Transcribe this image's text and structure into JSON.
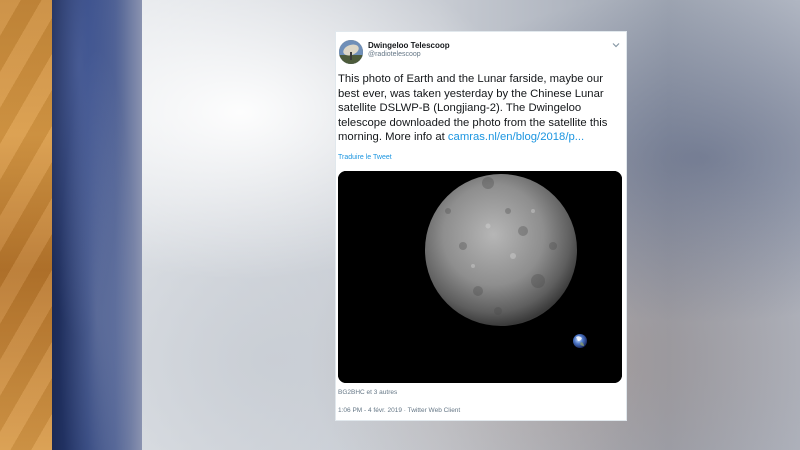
{
  "tweet": {
    "author_name": "Dwingeloo Telescoop",
    "author_handle": "@radiotelescoop",
    "text_main": "This photo of Earth and the Lunar farside, maybe our best ever, was taken yesterday by the Chinese Lunar satellite DSLWP-B (Longjiang-2). The Dwingeloo telescope downloaded the photo from the satellite this morning. More info at ",
    "text_link": "camras.nl/en/blog/2018/p...",
    "translate_label": "Traduire le Tweet",
    "likers": "BG2BHC et 3 autres",
    "timestamp": "1:06 PM - 4 févr. 2019 · Twitter Web Client"
  },
  "colors": {
    "link": "#1b95e0",
    "meta": "#657786",
    "text": "#14171a"
  },
  "icons": {
    "avatar": "radio-telescope-avatar",
    "menu": "chevron-down-icon"
  }
}
